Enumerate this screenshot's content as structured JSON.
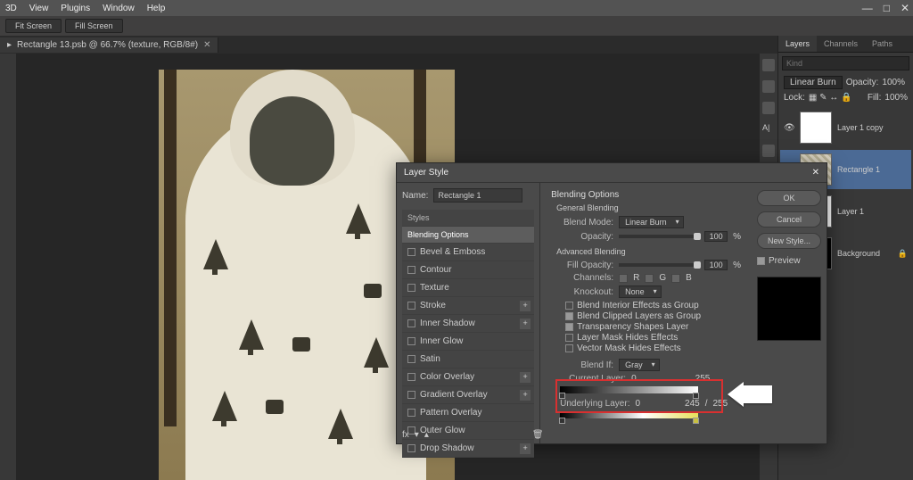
{
  "menu": {
    "items": [
      "3D",
      "View",
      "Plugins",
      "Window",
      "Help"
    ]
  },
  "options": {
    "btn1": "Fit Screen",
    "btn2": "Fill Screen"
  },
  "doc": {
    "tab": "Rectangle 13.psb @ 66.7% (texture, RGB/8#)"
  },
  "panels": {
    "tabs": [
      "Layers",
      "Channels",
      "Paths"
    ],
    "search_ph": "Kind",
    "blendmode": "Linear Burn",
    "opacity_lbl": "Opacity:",
    "opacity_val": "100%",
    "lock_lbl": "Lock:",
    "fill_lbl": "Fill:",
    "fill_val": "100%",
    "layers": [
      {
        "name": "Layer 1 copy"
      },
      {
        "name": "Rectangle 1"
      },
      {
        "name": "Layer 1"
      },
      {
        "name": "Background"
      }
    ]
  },
  "dialog": {
    "title": "Layer Style",
    "name_lbl": "Name:",
    "name_val": "Rectangle 1",
    "styles_hdr": "Styles",
    "style_items": [
      "Blending Options",
      "Bevel & Emboss",
      "Contour",
      "Texture",
      "Stroke",
      "Inner Shadow",
      "Inner Glow",
      "Satin",
      "Color Overlay",
      "Gradient Overlay",
      "Pattern Overlay",
      "Outer Glow",
      "Drop Shadow"
    ],
    "ok": "OK",
    "cancel": "Cancel",
    "newstyle": "New Style...",
    "preview": "Preview",
    "bo_title": "Blending Options",
    "gb": "General Blending",
    "bm_lbl": "Blend Mode:",
    "bm_val": "Linear Burn",
    "op_lbl": "Opacity:",
    "op_val": "100",
    "pct": "%",
    "ab": "Advanced Blending",
    "fo_lbl": "Fill Opacity:",
    "fo_val": "100",
    "ch_lbl": "Channels:",
    "ch_r": "R",
    "ch_g": "G",
    "ch_b": "B",
    "ko_lbl": "Knockout:",
    "ko_val": "None",
    "chk1": "Blend Interior Effects as Group",
    "chk2": "Blend Clipped Layers as Group",
    "chk3": "Transparency Shapes Layer",
    "chk4": "Layer Mask Hides Effects",
    "chk5": "Vector Mask Hides Effects",
    "bi_lbl": "Blend If:",
    "bi_val": "Gray",
    "cur_lbl": "Current Layer:",
    "cur_a": "0",
    "cur_b": "255",
    "und_lbl": "Underlying Layer:",
    "und_a": "0",
    "und_b": "245",
    "und_slash": "/",
    "und_c": "255"
  }
}
